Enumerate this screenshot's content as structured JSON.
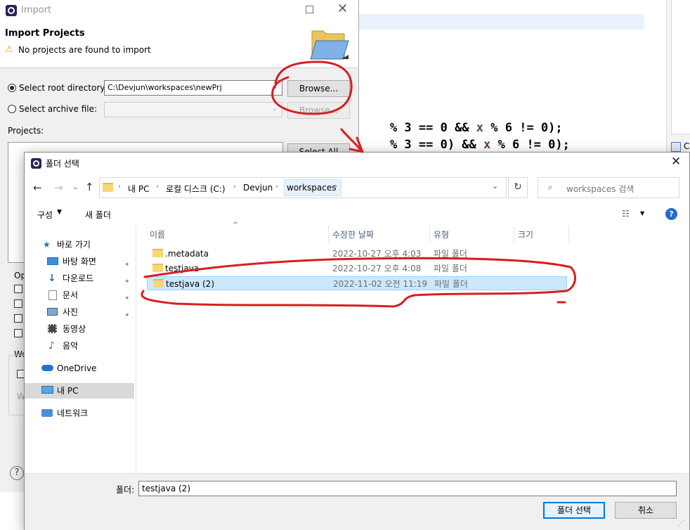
{
  "editor": {
    "code_line1": "% 3 == 0 && x % 6 != 0);",
    "code_line2": "% 3 == 0) && x % 6 != 0);",
    "var": "x",
    "right_panel_label": "C"
  },
  "import_dialog": {
    "title": "Import",
    "heading": "Import Projects",
    "warning": "No projects are found to import",
    "root_dir_label": "Select root directory:",
    "root_dir_value": "C:\\Devjun\\workspaces\\newPrj",
    "browse_label": "Browse...",
    "archive_label": "Select archive file:",
    "browse2_label": "Browse...",
    "projects_label": "Projects:",
    "select_all_label": "Select All",
    "options_label": "Op",
    "working_label": "Wo",
    "working_sub": "W",
    "help_label": "?"
  },
  "folder_dialog": {
    "title": "폴더 선택",
    "breadcrumb": [
      "내 PC",
      "로컬 디스크 (C:)",
      "Devjun",
      "workspaces"
    ],
    "search_placeholder": "workspaces 검색",
    "organize_label": "구성",
    "new_folder_label": "새 폴더",
    "help_label": "?",
    "nav": {
      "quick_access": "바로 가기",
      "desktop": "바탕 화면",
      "downloads": "다운로드",
      "documents": "문서",
      "pictures": "사진",
      "videos": "동영상",
      "music": "음악",
      "onedrive": "OneDrive",
      "this_pc": "내 PC",
      "network": "네트워크"
    },
    "columns": [
      "이름",
      "수정한 날짜",
      "유형",
      "크기"
    ],
    "rows": [
      {
        "name": ".metadata",
        "date": "2022-10-27 오후 4:03",
        "type": "파일 폴더"
      },
      {
        "name": "testjava",
        "date": "2022-10-27 오후 4:08",
        "type": "파일 폴더"
      },
      {
        "name": "testjava (2)",
        "date": "2022-11-02 오전 11:19",
        "type": "파일 폴더"
      }
    ],
    "folder_label": "폴더:",
    "folder_value": "testjava (2)",
    "select_button": "폴더 선택",
    "cancel_button": "취소"
  },
  "colors": {
    "annotation": "#d81e1e",
    "selection": "#cce8ff",
    "accent": "#0078d7"
  }
}
